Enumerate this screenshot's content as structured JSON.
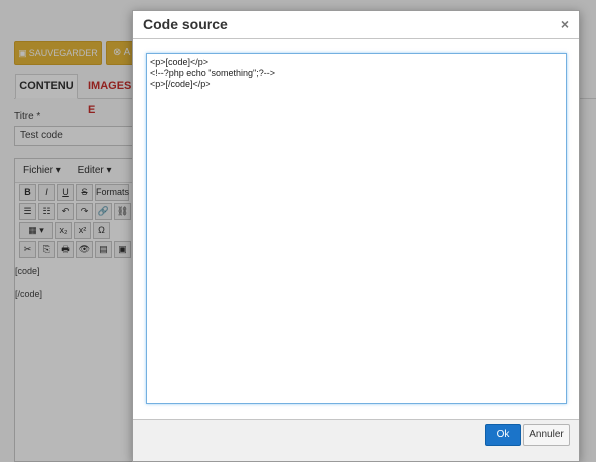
{
  "background": {
    "save_label": "SAUVEGARDER",
    "second_button_label": "A",
    "tabs": [
      "CONTENU",
      "IMAGES E"
    ],
    "title_label": "Titre *",
    "title_value": "Test code",
    "editor": {
      "menus": [
        "Fichier ▾",
        "Editer ▾"
      ],
      "toolbar_row1": [
        "B",
        "I",
        "U",
        "S",
        "Formats"
      ],
      "toolbar_row2": [
        "☰",
        "☷",
        "↶",
        "↷",
        "🔗",
        "⛓"
      ],
      "toolbar_row3": [
        "▦ ▾",
        "x₂",
        "x²",
        "Ω"
      ],
      "toolbar_row4": [
        "✂",
        "⎘",
        "🖶",
        "👁",
        "▤",
        "▣"
      ],
      "content_lines": [
        "[code]",
        "[/code]"
      ]
    }
  },
  "dialog": {
    "title": "Code source",
    "close_label": "×",
    "code": "<p>[code]</p>\n<!--?php echo \"something\";?-->\n<p>[/code]</p>",
    "ok_label": "Ok",
    "cancel_label": "Annuler"
  }
}
